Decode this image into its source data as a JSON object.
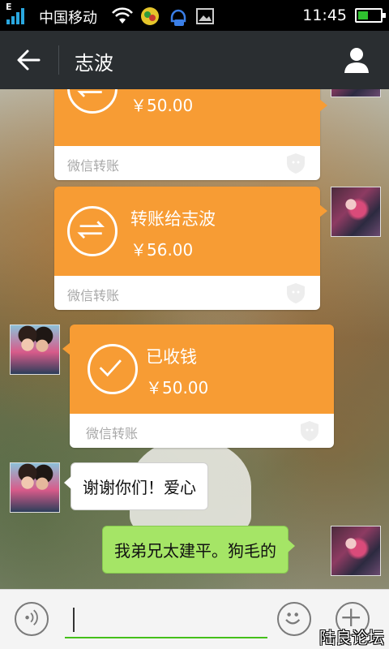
{
  "status_bar": {
    "network_type": "E",
    "carrier": "中国移动",
    "time": "11:45",
    "battery_color": "#2ec12e"
  },
  "header": {
    "back_icon": "back-arrow-icon",
    "title": "志波",
    "profile_icon": "person-icon"
  },
  "messages": [
    {
      "type": "transfer",
      "side": "right",
      "title": "",
      "amount": "￥50.00",
      "footer": "微信转账"
    },
    {
      "type": "transfer",
      "side": "right",
      "title": "转账给志波",
      "amount": "￥56.00",
      "footer": "微信转账"
    },
    {
      "type": "transfer",
      "side": "left",
      "title": "已收钱",
      "amount": "￥50.00",
      "footer": "微信转账"
    },
    {
      "type": "text",
      "side": "left",
      "text": "谢谢你们！爱心"
    },
    {
      "type": "text",
      "side": "right",
      "text": "我弟兄太建平。狗毛的"
    }
  ],
  "input_bar": {
    "value": "",
    "voice_icon": "voice-icon",
    "emoji_icon": "emoji-icon",
    "plus_icon": "plus-icon"
  },
  "watermark": "陆良论坛",
  "colors": {
    "transfer_orange": "#f79c34",
    "sent_green": "#a5e566",
    "header_bg": "#2a2e31"
  }
}
